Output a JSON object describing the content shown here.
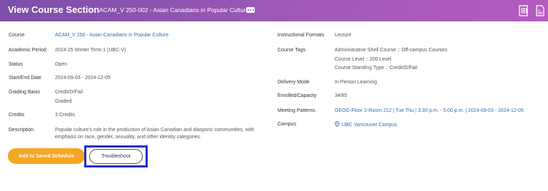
{
  "header": {
    "title": "View Course Section",
    "subtitle": "ACAM_V 250-002 - Asian Canadians in Popular Culture",
    "icons": [
      "more-options-icon",
      "export-excel-icon",
      "export-pdf-icon"
    ]
  },
  "left": {
    "course": {
      "label": "Course",
      "value": "ACAM_V 250 - Asian Canadians in Popular Culture"
    },
    "academic_period": {
      "label": "Academic Period",
      "value": "2024-25 Winter Term 1 (UBC-V)"
    },
    "status": {
      "label": "Status",
      "value": "Open"
    },
    "dates": {
      "label": "Start/End Date",
      "value": "2024-09-03 - 2024-12-05"
    },
    "grading": {
      "label": "Grading Basis",
      "values": [
        "Credit/D/Fail",
        "Graded"
      ]
    },
    "credits": {
      "label": "Credits",
      "value": "3 Credits"
    },
    "description": {
      "label": "Description",
      "value": "Popular culture's role in the production of Asian Canadian and diasporic communities, with emphasis on race, gender, sexuality, and other identity categories."
    }
  },
  "right": {
    "formats": {
      "label": "Instructional Formats",
      "value": "Lecture"
    },
    "tags": {
      "label": "Course Tags",
      "values": [
        "Administrative Shell Course :: Off-campus Courses",
        "Course Level :: 200 Level",
        "Course Standing Type :: Credit/D/Fail"
      ]
    },
    "delivery": {
      "label": "Delivery Mode",
      "value": "In Person Learning"
    },
    "enrolled": {
      "label": "Enrolled/Capacity",
      "value": "34/85"
    },
    "meeting": {
      "label": "Meeting Patterns",
      "value": "GEOG-Floor 2-Room 212 | Tue Thu | 3:30 p.m. - 5:00 p.m. | 2024-09-03 - 2024-12-05"
    },
    "campus": {
      "label": "Campus",
      "value": "UBC Vancouver Campus"
    }
  },
  "actions": {
    "save_label": "Add to Saved Schedule",
    "troubleshoot_label": "Troubleshoot"
  },
  "colors": {
    "header_start": "#7b4ea8",
    "header_end": "#b45bc0",
    "link": "#2e6fb5",
    "save_button": "#f5a623",
    "focus_outline": "#1c2fc9"
  }
}
